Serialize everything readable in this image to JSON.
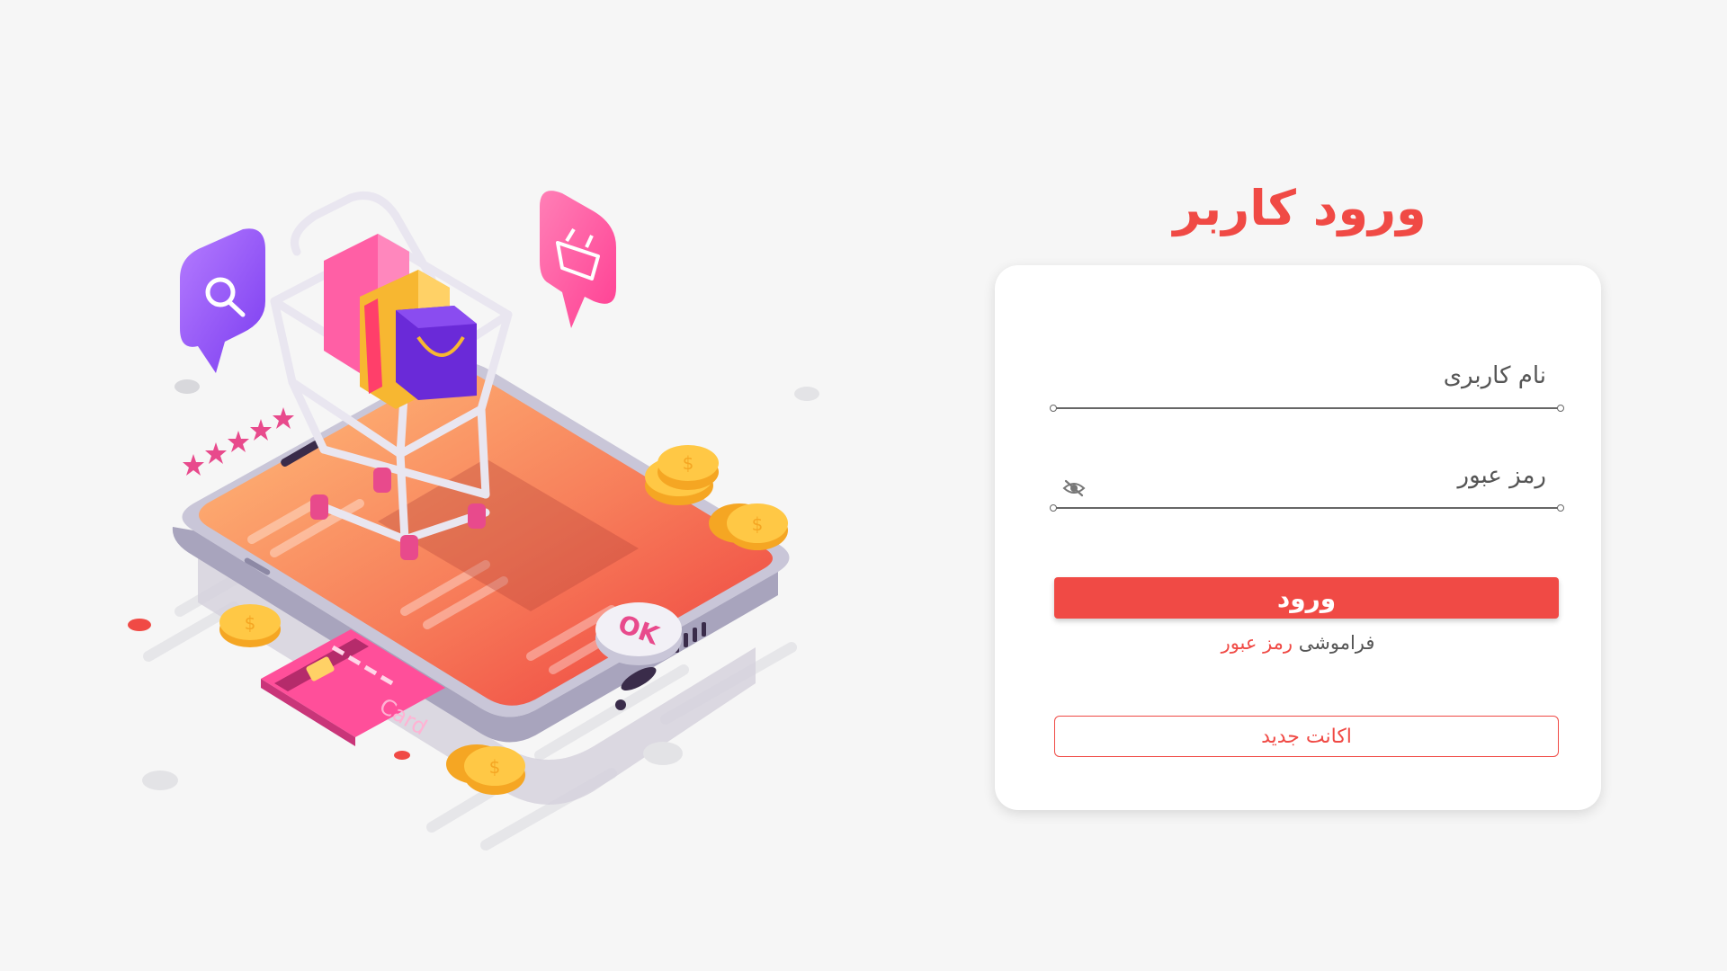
{
  "page": {
    "title": "ورود کاربر"
  },
  "form": {
    "username_label": "نام کاربری",
    "password_label": "رمز عبور",
    "login_button": "ورود",
    "forgot_prefix": "فراموشی",
    "forgot_link": "رمز عبور",
    "new_account_button": "اکانت جدید"
  },
  "illustration": {
    "ok_text": "OK",
    "card_text": "Card",
    "coin_symbol": "$"
  },
  "icons": {
    "password_toggle": "eye-off-icon",
    "search": "search-icon",
    "basket": "basket-icon"
  },
  "colors": {
    "accent": "#f04a45",
    "background": "#f6f6f6"
  }
}
